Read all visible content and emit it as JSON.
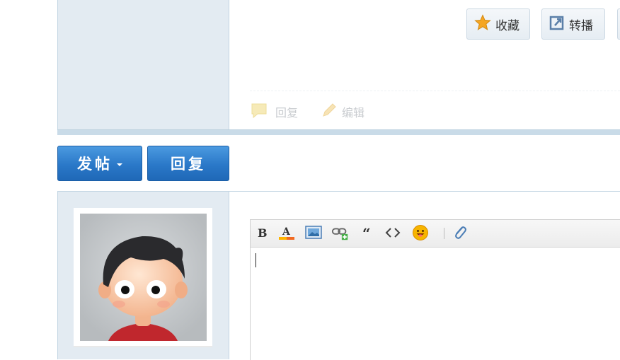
{
  "post": {
    "actions": {
      "favorite_label": "收藏",
      "share_label": "转播"
    },
    "footer_links": {
      "reply_label": "回复",
      "edit_label": "编辑"
    }
  },
  "buttons": {
    "new_post_label": "发帖",
    "reply_label": "回复"
  },
  "editor": {
    "toolbar": [
      {
        "icon": "bold-icon"
      },
      {
        "icon": "font-color-icon"
      },
      {
        "icon": "image-icon"
      },
      {
        "icon": "link-icon"
      },
      {
        "icon": "quote-icon"
      },
      {
        "icon": "code-icon"
      },
      {
        "icon": "smiley-icon"
      },
      {
        "icon": "attachment-icon"
      }
    ],
    "value": ""
  },
  "colors": {
    "sidebar_bg": "#e3ebf2",
    "primary_button": "#2a78c8",
    "accent_star": "#f5a623"
  }
}
